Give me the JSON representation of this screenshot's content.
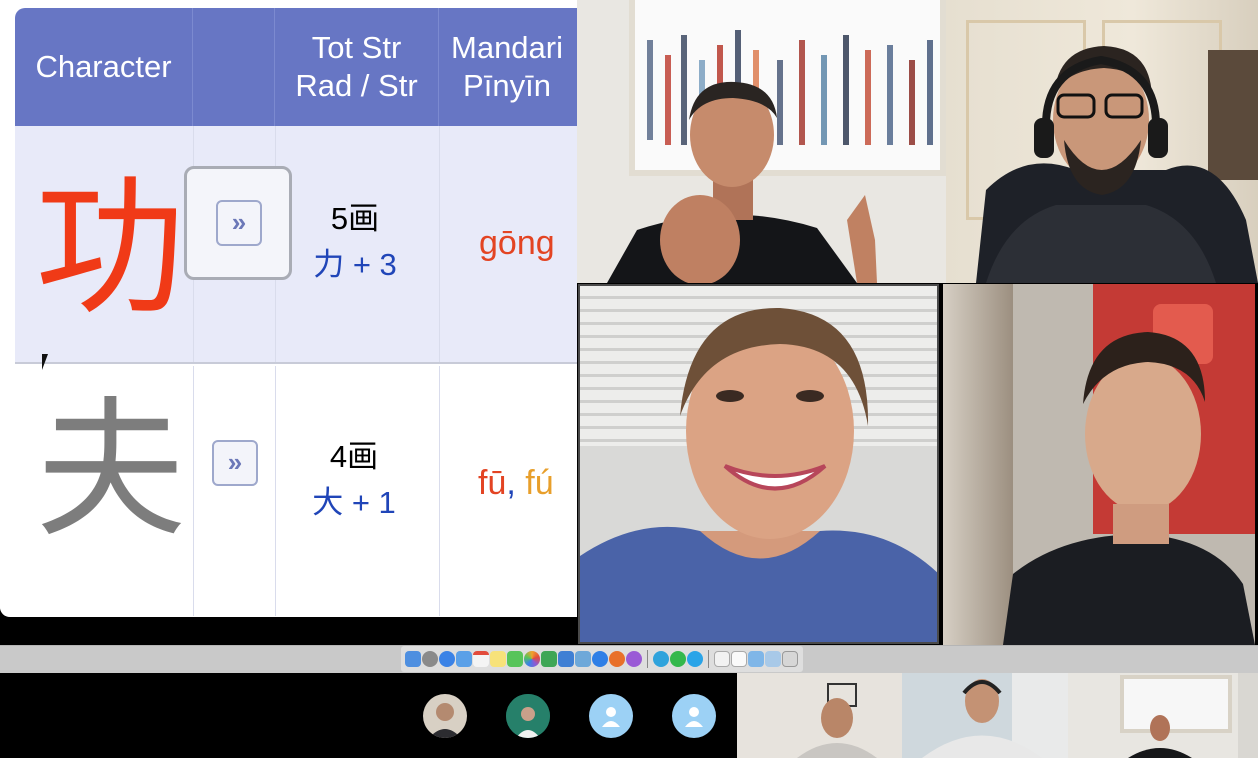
{
  "dictionary": {
    "headers": {
      "character": "Character",
      "blank": "",
      "strokes_line1": "Tot Str",
      "strokes_line2": "Rad / Str",
      "mandarin_line1": "Mandari",
      "mandarin_line2": "Pīnyīn"
    },
    "rows": [
      {
        "character": "功",
        "strokes_total": "5画",
        "radical_strokes": "力 + 3",
        "pinyin_1": "gōng",
        "pinyin_sep": "",
        "pinyin_2": ""
      },
      {
        "character": "夫",
        "strokes_total": "4画",
        "radical_strokes": "大 + 1",
        "pinyin_1": "fū",
        "pinyin_sep": ", ",
        "pinyin_2": "fú"
      }
    ],
    "expand_glyph": "»"
  },
  "video_grid": {
    "tiles": [
      {
        "id": "presenter"
      },
      {
        "id": "participant-headset"
      },
      {
        "id": "participant-smiling"
      },
      {
        "id": "participant-young-man"
      }
    ]
  },
  "dock": {
    "icons": [
      "finder-icon",
      "launchpad-icon",
      "safari-icon",
      "mail-icon",
      "calendar-icon",
      "notes-icon",
      "messages-icon",
      "photos-icon",
      "numbers-icon",
      "keynote-icon",
      "preview-icon",
      "app-store-icon",
      "firefox-icon",
      "podcasts-icon",
      "telegram-icon",
      "whatsapp-icon",
      "skype-icon",
      "document-icon",
      "text-edit-icon",
      "folder-icon",
      "downloads-icon",
      "trash-icon"
    ]
  },
  "participant_strip": {
    "avatars": [
      "participant-avatar-photo-1",
      "participant-avatar-photo-2",
      "participant-avatar-default-1",
      "participant-avatar-default-2"
    ]
  },
  "colors": {
    "header": "#6776c4",
    "row_highlight": "#e8eaf9",
    "char_red": "#f03a17",
    "char_gray": "#7d7d7d",
    "radical_blue": "#2045b8",
    "pinyin_red": "#e34423",
    "pinyin_orange": "#e89f2b"
  }
}
